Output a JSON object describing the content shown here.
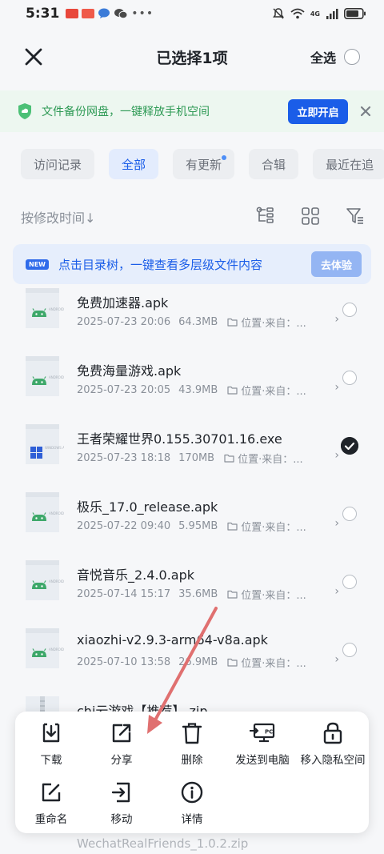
{
  "status_bar": {
    "time": "5:31",
    "network": "4G"
  },
  "header": {
    "title": "已选择1项",
    "select_all": "全选"
  },
  "banner": {
    "text": "文件备份网盘，一键释放手机空间",
    "button": "立即开启"
  },
  "tabs": [
    {
      "label": "访问记录",
      "active": false,
      "dot": false
    },
    {
      "label": "全部",
      "active": true,
      "dot": false
    },
    {
      "label": "有更新",
      "active": false,
      "dot": true
    },
    {
      "label": "合辑",
      "active": false,
      "dot": false
    },
    {
      "label": "最近在追",
      "active": false,
      "dot": false
    }
  ],
  "sort": {
    "label": "按修改时间↓"
  },
  "tip": {
    "badge": "NEW",
    "text": "点击目录树，一键查看多层级文件内容",
    "button": "去体验"
  },
  "files": [
    {
      "name": "免费加速器.apk",
      "date": "2025-07-23 20:06",
      "size": "64.3MB",
      "location": "位置·来自：...",
      "type": "android",
      "checked": false
    },
    {
      "name": "免费海量游戏.apk",
      "date": "2025-07-23 20:05",
      "size": "43.9MB",
      "location": "位置·来自：...",
      "type": "android",
      "checked": false
    },
    {
      "name": "王者荣耀世界0.155.30701.16.exe",
      "date": "2025-07-23 18:18",
      "size": "170MB",
      "location": "位置·来自：...",
      "type": "windows",
      "checked": true
    },
    {
      "name": "极乐_17.0_release.apk",
      "date": "2025-07-22 09:40",
      "size": "5.95MB",
      "location": "位置·来自：...",
      "type": "android",
      "checked": false
    },
    {
      "name": "音悦音乐_2.4.0.apk",
      "date": "2025-07-14 15:17",
      "size": "35.6MB",
      "location": "位置·来自：...",
      "type": "android",
      "checked": false
    },
    {
      "name": "xiaozhi-v2.9.3-arm64-v8a.apk",
      "date": "2025-07-10 13:58",
      "size": "26.9MB",
      "location": "位置·来自：...",
      "type": "android",
      "checked": false
    },
    {
      "name": "chi云游戏【推荐】.zip",
      "date": "",
      "size": "",
      "location": "",
      "type": "zip",
      "checked": false
    }
  ],
  "thumb_labels": {
    "android": "ANDROID APP",
    "windows": "WINDOWS APP"
  },
  "actions": [
    {
      "label": "下载",
      "icon": "download-icon"
    },
    {
      "label": "分享",
      "icon": "share-icon"
    },
    {
      "label": "删除",
      "icon": "trash-icon"
    },
    {
      "label": "发送到电脑",
      "icon": "send-to-pc-icon"
    },
    {
      "label": "移入隐私空间",
      "icon": "lock-icon"
    },
    {
      "label": "重命名",
      "icon": "rename-icon"
    },
    {
      "label": "移动",
      "icon": "move-icon"
    },
    {
      "label": "详情",
      "icon": "info-icon"
    }
  ],
  "under_sheet_text": "WechatRealFriends_1.0.2.zip",
  "colors": {
    "accent": "#1a5de8",
    "banner_green": "#2e9a55",
    "annotation_arrow": "#e07070"
  }
}
